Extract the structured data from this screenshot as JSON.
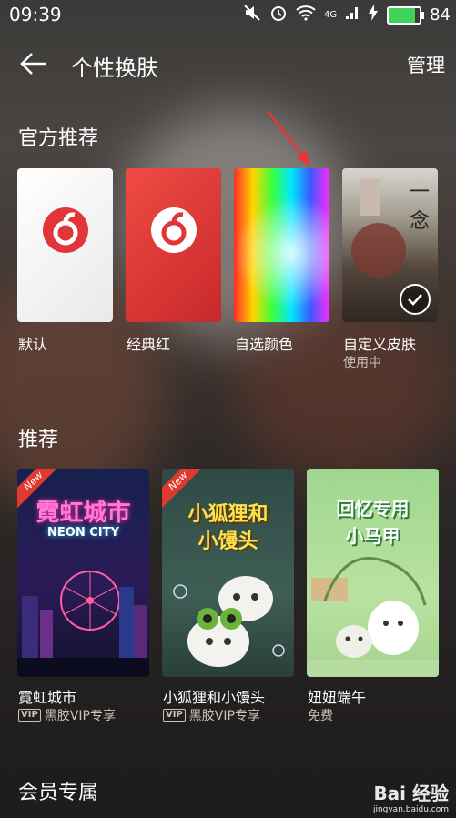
{
  "status": {
    "time": "09:39",
    "network": "4G",
    "battery": "84",
    "battery_level": 0.84
  },
  "header": {
    "title": "个性换肤",
    "manage": "管理"
  },
  "official": {
    "title": "官方推荐",
    "items": [
      {
        "label": "默认"
      },
      {
        "label": "经典红"
      },
      {
        "label": "自选颜色"
      },
      {
        "label": "自定义皮肤",
        "status": "使用中",
        "preview_text": "一念"
      }
    ]
  },
  "recommend": {
    "title": "推荐",
    "items": [
      {
        "label": "霓虹城市",
        "sub": "黑胶VIP专享",
        "badge": "New",
        "vip_mark": "VIP",
        "thumb_title": "霓虹城市",
        "thumb_subtitle": "NEON CITY"
      },
      {
        "label": "小狐狸和小馒头",
        "sub": "黑胶VIP专享",
        "badge": "New",
        "vip_mark": "VIP",
        "thumb_title_1": "小狐狸和",
        "thumb_title_2": "小馒头"
      },
      {
        "label": "妞妞端午",
        "sub": "免费",
        "thumb_title_1": "回忆专用",
        "thumb_title_2": "小马甲"
      }
    ]
  },
  "member": {
    "title": "会员专属"
  },
  "watermark": {
    "main": "Bai 经验",
    "sub": "jingyan.baidu.com"
  },
  "colors": {
    "netease_red": "#e0363a",
    "selected_check": "#ffffff",
    "battery_green": "#3ed35b"
  }
}
